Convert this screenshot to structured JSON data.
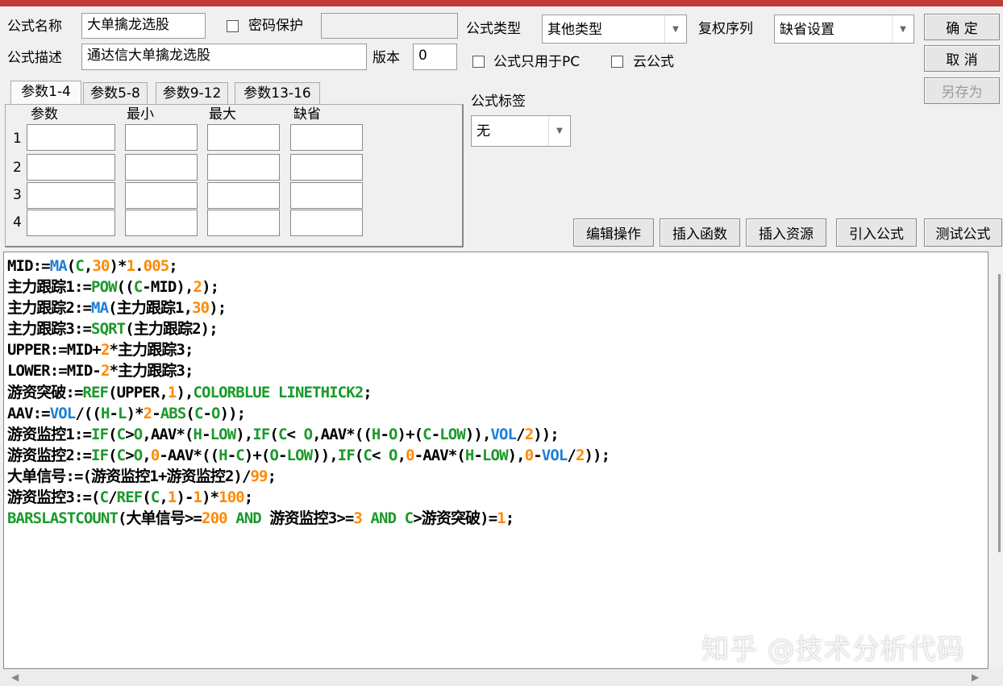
{
  "header": {
    "name_label": "公式名称",
    "name_value": "大单擒龙选股",
    "password_label": "密码保护",
    "desc_label": "公式描述",
    "desc_value": "通达信大单擒龙选股",
    "version_label": "版本",
    "version_value": "0",
    "type_label": "公式类型",
    "type_value": "其他类型",
    "rights_label": "复权序列",
    "rights_value": "缺省设置",
    "pc_only_label": "公式只用于PC",
    "cloud_label": "云公式",
    "tag_label": "公式标签",
    "tag_value": "无"
  },
  "buttons": {
    "ok": "确  定",
    "cancel": "取  消",
    "save_as": "另存为",
    "edit_ops": "编辑操作",
    "insert_func": "插入函数",
    "insert_res": "插入资源",
    "import_formula": "引入公式",
    "test_formula": "测试公式"
  },
  "param_tabs": [
    "参数1-4",
    "参数5-8",
    "参数9-12",
    "参数13-16"
  ],
  "param_headers": [
    "参数",
    "最小",
    "最大",
    "缺省"
  ],
  "param_rows": [
    "1",
    "2",
    "3",
    "4"
  ],
  "code_lines": [
    [
      [
        "k",
        "MID:="
      ],
      [
        "b",
        "MA"
      ],
      [
        "k",
        "("
      ],
      [
        "f",
        "C"
      ],
      [
        "k",
        ","
      ],
      [
        "n",
        "30"
      ],
      [
        "k",
        ")*"
      ],
      [
        "n",
        "1"
      ],
      [
        "k",
        "."
      ],
      [
        "n",
        "005"
      ],
      [
        "k",
        ";"
      ]
    ],
    [
      [
        "k",
        "主力跟踪1:="
      ],
      [
        "f",
        "POW"
      ],
      [
        "k",
        "(("
      ],
      [
        "f",
        "C"
      ],
      [
        "k",
        "-MID),"
      ],
      [
        "n",
        "2"
      ],
      [
        "k",
        ");"
      ]
    ],
    [
      [
        "k",
        "主力跟踪2:="
      ],
      [
        "b",
        "MA"
      ],
      [
        "k",
        "(主力跟踪1,"
      ],
      [
        "n",
        "30"
      ],
      [
        "k",
        ");"
      ]
    ],
    [
      [
        "k",
        "主力跟踪3:="
      ],
      [
        "f",
        "SQRT"
      ],
      [
        "k",
        "(主力跟踪2);"
      ]
    ],
    [
      [
        "k",
        "UPPER:=MID+"
      ],
      [
        "n",
        "2"
      ],
      [
        "k",
        "*主力跟踪3;"
      ]
    ],
    [
      [
        "k",
        "LOWER:=MID-"
      ],
      [
        "n",
        "2"
      ],
      [
        "k",
        "*主力跟踪3;"
      ]
    ],
    [
      [
        "k",
        "游资突破:="
      ],
      [
        "f",
        "REF"
      ],
      [
        "k",
        "(UPPER,"
      ],
      [
        "n",
        "1"
      ],
      [
        "k",
        "),"
      ],
      [
        "z",
        "COLORBLUE LINETHICK2"
      ],
      [
        "k",
        ";"
      ]
    ],
    [
      [
        "k",
        "AAV:="
      ],
      [
        "b",
        "VOL"
      ],
      [
        "k",
        "/(("
      ],
      [
        "f",
        "H"
      ],
      [
        "k",
        "-"
      ],
      [
        "f",
        "L"
      ],
      [
        "k",
        ")*"
      ],
      [
        "n",
        "2"
      ],
      [
        "k",
        "-"
      ],
      [
        "f",
        "ABS"
      ],
      [
        "k",
        "("
      ],
      [
        "f",
        "C"
      ],
      [
        "k",
        "-"
      ],
      [
        "f",
        "O"
      ],
      [
        "k",
        "));"
      ]
    ],
    [
      [
        "k",
        "游资监控1:="
      ],
      [
        "f",
        "IF"
      ],
      [
        "k",
        "("
      ],
      [
        "f",
        "C"
      ],
      [
        "k",
        ">"
      ],
      [
        "f",
        "O"
      ],
      [
        "k",
        ",AAV*("
      ],
      [
        "f",
        "H"
      ],
      [
        "k",
        "-"
      ],
      [
        "f",
        "LOW"
      ],
      [
        "k",
        "),"
      ],
      [
        "f",
        "IF"
      ],
      [
        "k",
        "("
      ],
      [
        "f",
        "C"
      ],
      [
        "k",
        "< "
      ],
      [
        "f",
        "O"
      ],
      [
        "k",
        ",AAV*(("
      ],
      [
        "f",
        "H"
      ],
      [
        "k",
        "-"
      ],
      [
        "f",
        "O"
      ],
      [
        "k",
        ")+("
      ],
      [
        "f",
        "C"
      ],
      [
        "k",
        "-"
      ],
      [
        "f",
        "LOW"
      ],
      [
        "k",
        ")),"
      ],
      [
        "b",
        "VOL"
      ],
      [
        "k",
        "/"
      ],
      [
        "n",
        "2"
      ],
      [
        "k",
        "));"
      ]
    ],
    [
      [
        "k",
        "游资监控2:="
      ],
      [
        "f",
        "IF"
      ],
      [
        "k",
        "("
      ],
      [
        "f",
        "C"
      ],
      [
        "k",
        ">"
      ],
      [
        "f",
        "O"
      ],
      [
        "k",
        ","
      ],
      [
        "n",
        "0"
      ],
      [
        "k",
        "-AAV*(("
      ],
      [
        "f",
        "H"
      ],
      [
        "k",
        "-"
      ],
      [
        "f",
        "C"
      ],
      [
        "k",
        ")+("
      ],
      [
        "f",
        "O"
      ],
      [
        "k",
        "-"
      ],
      [
        "f",
        "LOW"
      ],
      [
        "k",
        ")),"
      ],
      [
        "f",
        "IF"
      ],
      [
        "k",
        "("
      ],
      [
        "f",
        "C"
      ],
      [
        "k",
        "< "
      ],
      [
        "f",
        "O"
      ],
      [
        "k",
        ","
      ],
      [
        "n",
        "0"
      ],
      [
        "k",
        "-AAV*("
      ],
      [
        "f",
        "H"
      ],
      [
        "k",
        "-"
      ],
      [
        "f",
        "LOW"
      ],
      [
        "k",
        "),"
      ],
      [
        "n",
        "0"
      ],
      [
        "k",
        "-"
      ],
      [
        "b",
        "VOL"
      ],
      [
        "k",
        "/"
      ],
      [
        "n",
        "2"
      ],
      [
        "k",
        "));"
      ]
    ],
    [
      [
        "k",
        "大单信号:=(游资监控1+游资监控2)/"
      ],
      [
        "n",
        "99"
      ],
      [
        "k",
        ";"
      ]
    ],
    [
      [
        "k",
        "游资监控3:=("
      ],
      [
        "f",
        "C"
      ],
      [
        "k",
        "/"
      ],
      [
        "f",
        "REF"
      ],
      [
        "k",
        "("
      ],
      [
        "f",
        "C"
      ],
      [
        "k",
        ","
      ],
      [
        "n",
        "1"
      ],
      [
        "k",
        ")-"
      ],
      [
        "n",
        "1"
      ],
      [
        "k",
        ")*"
      ],
      [
        "n",
        "100"
      ],
      [
        "k",
        ";"
      ]
    ],
    [
      [
        "f",
        "BARSLASTCOUNT"
      ],
      [
        "k",
        "(大单信号>="
      ],
      [
        "n",
        "200"
      ],
      [
        "k",
        " "
      ],
      [
        "z",
        "AND"
      ],
      [
        "k",
        " 游资监控3>="
      ],
      [
        "n",
        "3"
      ],
      [
        "k",
        " "
      ],
      [
        "z",
        "AND"
      ],
      [
        "k",
        " "
      ],
      [
        "f",
        "C"
      ],
      [
        "k",
        ">游资突破)="
      ],
      [
        "n",
        "1"
      ],
      [
        "k",
        ";"
      ]
    ]
  ],
  "watermark": "知乎 @技术分析代码"
}
